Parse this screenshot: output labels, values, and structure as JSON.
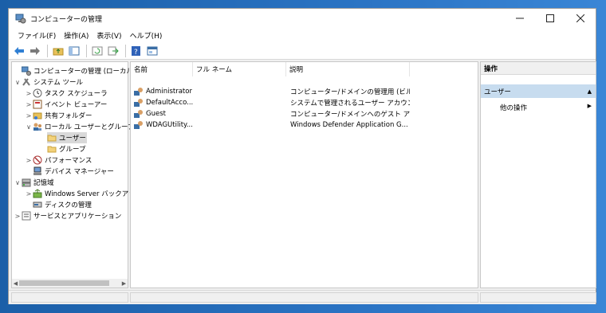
{
  "window": {
    "title": "コンピューターの管理"
  },
  "menu": [
    "ファイル(F)",
    "操作(A)",
    "表示(V)",
    "ヘルプ(H)"
  ],
  "toolbar": [
    "back-icon",
    "forward-icon",
    "up-folder-icon",
    "console-tree-icon",
    "refresh-icon",
    "export-icon",
    "help-icon",
    "properties-icon"
  ],
  "tree": [
    {
      "label": "コンピューターの管理 (ローカル)",
      "level": 0,
      "expander": ""
    },
    {
      "label": "システム ツール",
      "level": 0,
      "expander": "∨"
    },
    {
      "label": "タスク スケジューラ",
      "level": 1,
      "expander": ">"
    },
    {
      "label": "イベント ビューアー",
      "level": 1,
      "expander": ">"
    },
    {
      "label": "共有フォルダー",
      "level": 1,
      "expander": ">"
    },
    {
      "label": "ローカル ユーザーとグループ",
      "level": 1,
      "expander": "∨"
    },
    {
      "label": "ユーザー",
      "level": 2,
      "expander": ""
    },
    {
      "label": "グループ",
      "level": 2,
      "expander": ""
    },
    {
      "label": "パフォーマンス",
      "level": 1,
      "expander": ">"
    },
    {
      "label": "デバイス マネージャー",
      "level": 1,
      "expander": ""
    },
    {
      "label": "記憶域",
      "level": 0,
      "expander": "∨"
    },
    {
      "label": "Windows Server バックアップ",
      "level": 1,
      "expander": ">"
    },
    {
      "label": "ディスクの管理",
      "level": 1,
      "expander": ""
    },
    {
      "label": "サービスとアプリケーション",
      "level": 0,
      "expander": ">"
    }
  ],
  "list": {
    "columns": [
      "名前",
      "フル ネーム",
      "説明"
    ],
    "rows": [
      {
        "name": "Administrator",
        "fullname": "",
        "desc": "コンピューター/ドメインの管理用 (ビルト..."
      },
      {
        "name": "DefaultAcco...",
        "fullname": "",
        "desc": "システムで管理されるユーザー アカウン..."
      },
      {
        "name": "Guest",
        "fullname": "",
        "desc": "コンピューター/ドメインへのゲスト アクセ..."
      },
      {
        "name": "WDAGUtility...",
        "fullname": "",
        "desc": "Windows Defender Application G..."
      }
    ]
  },
  "actions": {
    "header": "操作",
    "section": "ユーザー",
    "item": "他の操作"
  }
}
